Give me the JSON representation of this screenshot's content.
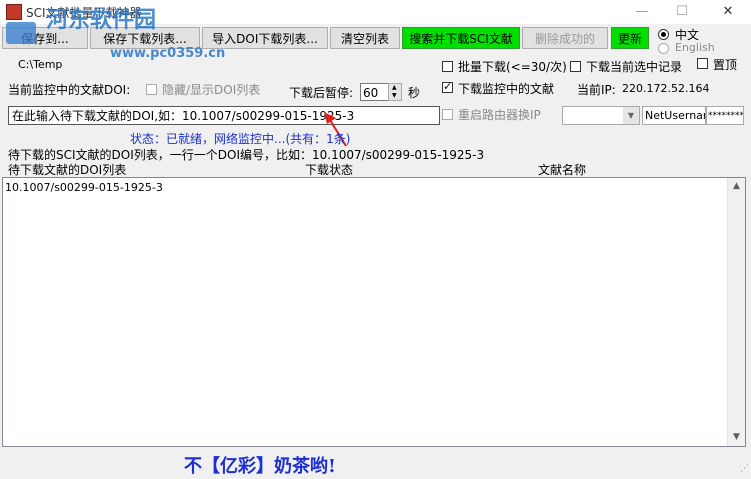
{
  "window": {
    "title": "SCI文献批量下载神器",
    "minimize": "—",
    "maximize": "☐",
    "close": "✕"
  },
  "watermark": {
    "brand": "河东软件园",
    "url": "www.pc0359.cn"
  },
  "toolbar": {
    "save_to": "保存到...",
    "save_list": "保存下载列表...",
    "import_list": "导入DOI下载列表...",
    "clear_list": "清空列表",
    "search_download": "搜索并下载SCI文献",
    "delete_success": "删除成功的",
    "update": "更新"
  },
  "language": {
    "chinese": "中文",
    "english": "English"
  },
  "save_path": "C:\\Temp",
  "options": {
    "batch_download": "批量下载(<=30/次)",
    "download_selected": "下载当前选中记录",
    "pin_top": "置顶",
    "download_monitored": "下载监控中的文献",
    "reboot_router": "重启路由器换IP"
  },
  "monitor": {
    "label": "当前监控中的文献DOI:",
    "toggle_doi_list": "隐藏/显示DOI列表",
    "pause_label": "下载后暂停:",
    "pause_value": "60",
    "pause_unit": "秒",
    "ip_label": "当前IP:",
    "ip_value": "220.172.52.164"
  },
  "doi_input": {
    "value": "在此输入待下载文献的DOI,如：10.1007/s00299-015-1925-3"
  },
  "router": {
    "username": "NetUsernam",
    "password": "*********"
  },
  "status": {
    "text": "状态：已就绪，网络监控中...(共有：1条)"
  },
  "hint": "待下载的SCI文献的DOI列表，一行一个DOI编号，比如：10.1007/s00299-015-1925-3",
  "list": {
    "columns": [
      "待下载文献的DOI列表",
      "下载状态",
      "文献名称"
    ],
    "rows": [
      {
        "doi": "10.1007/s00299-015-1925-3",
        "status": "",
        "name": ""
      }
    ]
  },
  "ad": "不【亿彩】奶茶哟!",
  "colors": {
    "green_button": "#00e000",
    "status_blue": "#1d2fd0",
    "watermark_blue": "#2a77c8"
  }
}
